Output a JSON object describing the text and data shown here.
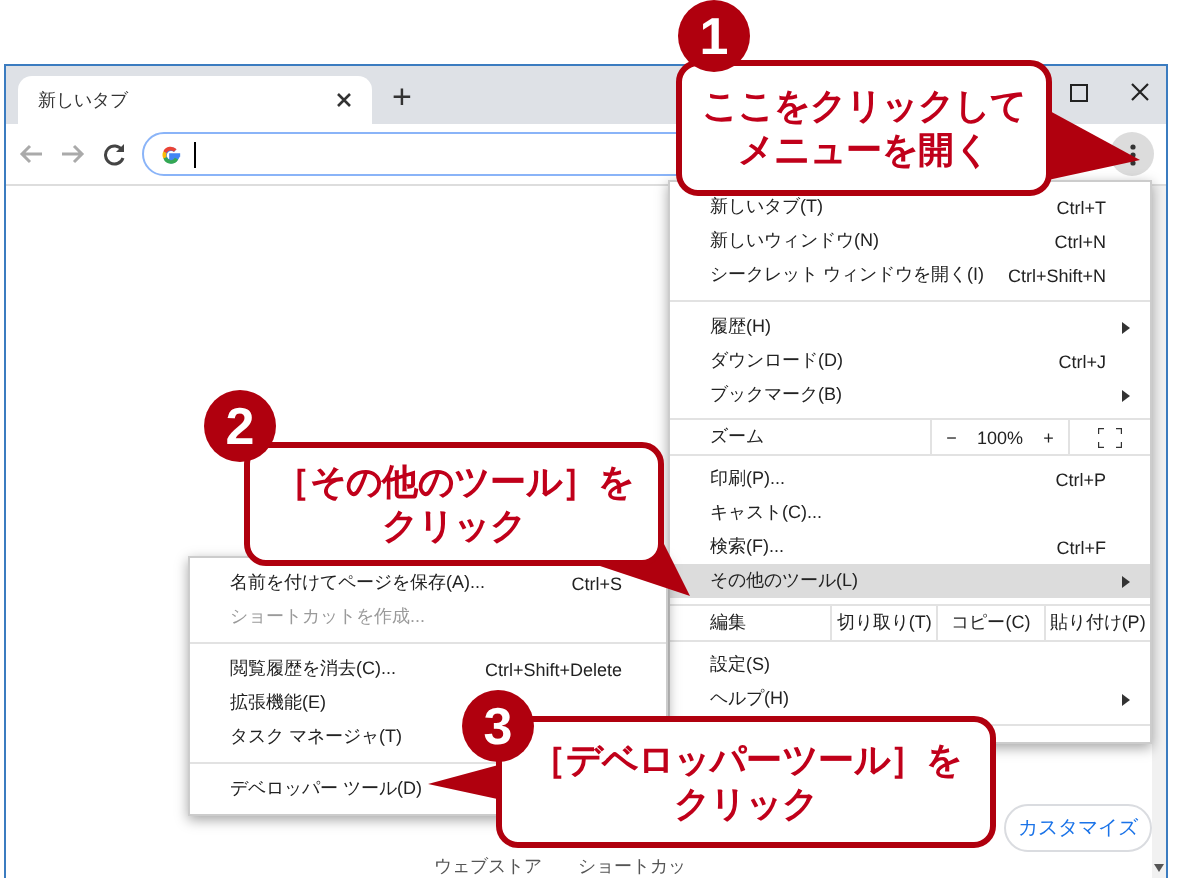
{
  "browser": {
    "tab": {
      "title": "新しいタブ",
      "selected": true
    },
    "new_tab": "+"
  },
  "menu": {
    "items": [
      {
        "kind": "item",
        "label": "新しいタブ(T)",
        "shortcut": "Ctrl+T",
        "submenu": false,
        "selected": false
      },
      {
        "kind": "item",
        "label": "新しいウィンドウ(N)",
        "shortcut": "Ctrl+N",
        "submenu": false,
        "selected": false
      },
      {
        "kind": "item",
        "label": "シークレット ウィンドウを開く(I)",
        "shortcut": "Ctrl+Shift+N",
        "submenu": false,
        "selected": false
      },
      {
        "kind": "separator"
      },
      {
        "kind": "item",
        "label": "履歴(H)",
        "submenu": true,
        "selected": false
      },
      {
        "kind": "item",
        "label": "ダウンロード(D)",
        "shortcut": "Ctrl+J",
        "submenu": false,
        "selected": false
      },
      {
        "kind": "item",
        "label": "ブックマーク(B)",
        "submenu": true,
        "selected": false
      },
      {
        "kind": "zoom",
        "label": "ズーム",
        "minus": "−",
        "value": "100%",
        "plus": "+"
      },
      {
        "kind": "item",
        "label": "印刷(P)...",
        "shortcut": "Ctrl+P",
        "submenu": false,
        "selected": false
      },
      {
        "kind": "item",
        "label": "キャスト(C)...",
        "submenu": false,
        "selected": false
      },
      {
        "kind": "item",
        "label": "検索(F)...",
        "shortcut": "Ctrl+F",
        "submenu": false,
        "selected": false
      },
      {
        "kind": "item",
        "label": "その他のツール(L)",
        "submenu": true,
        "selected": true
      },
      {
        "kind": "edit",
        "label": "編集",
        "cut": "切り取り(T)",
        "copy": "コピー(C)",
        "paste": "貼り付け(P)"
      },
      {
        "kind": "item",
        "label": "設定(S)",
        "submenu": false,
        "selected": false
      },
      {
        "kind": "item",
        "label": "ヘルプ(H)",
        "submenu": true,
        "selected": false
      },
      {
        "kind": "separator"
      }
    ]
  },
  "submenu": {
    "items": [
      {
        "kind": "item",
        "label": "名前を付けてページを保存(A)...",
        "shortcut": "Ctrl+S",
        "disabled": false
      },
      {
        "kind": "item",
        "label": "ショートカットを作成...",
        "disabled": true
      },
      {
        "kind": "separator"
      },
      {
        "kind": "item",
        "label": "閲覧履歴を消去(C)...",
        "shortcut": "Ctrl+Shift+Delete",
        "disabled": false
      },
      {
        "kind": "item",
        "label": "拡張機能(E)",
        "disabled": false
      },
      {
        "kind": "item",
        "label": "タスク マネージャ(T)",
        "disabled": false
      },
      {
        "kind": "separator"
      },
      {
        "kind": "item",
        "label": "デベロッパー ツール(D)",
        "disabled": false
      }
    ]
  },
  "page": {
    "customize": "カスタマイズ",
    "shortcuts": [
      "ウェブストア",
      "ショートカッ"
    ]
  },
  "callouts": [
    {
      "number": "1",
      "lines": [
        "ここをクリックして",
        "メニューを開く"
      ]
    },
    {
      "number": "2",
      "lines": [
        "［その他のツール］を",
        "クリック"
      ]
    },
    {
      "number": "3",
      "lines": [
        "［デベロッパーツール］を",
        "クリック"
      ]
    }
  ]
}
